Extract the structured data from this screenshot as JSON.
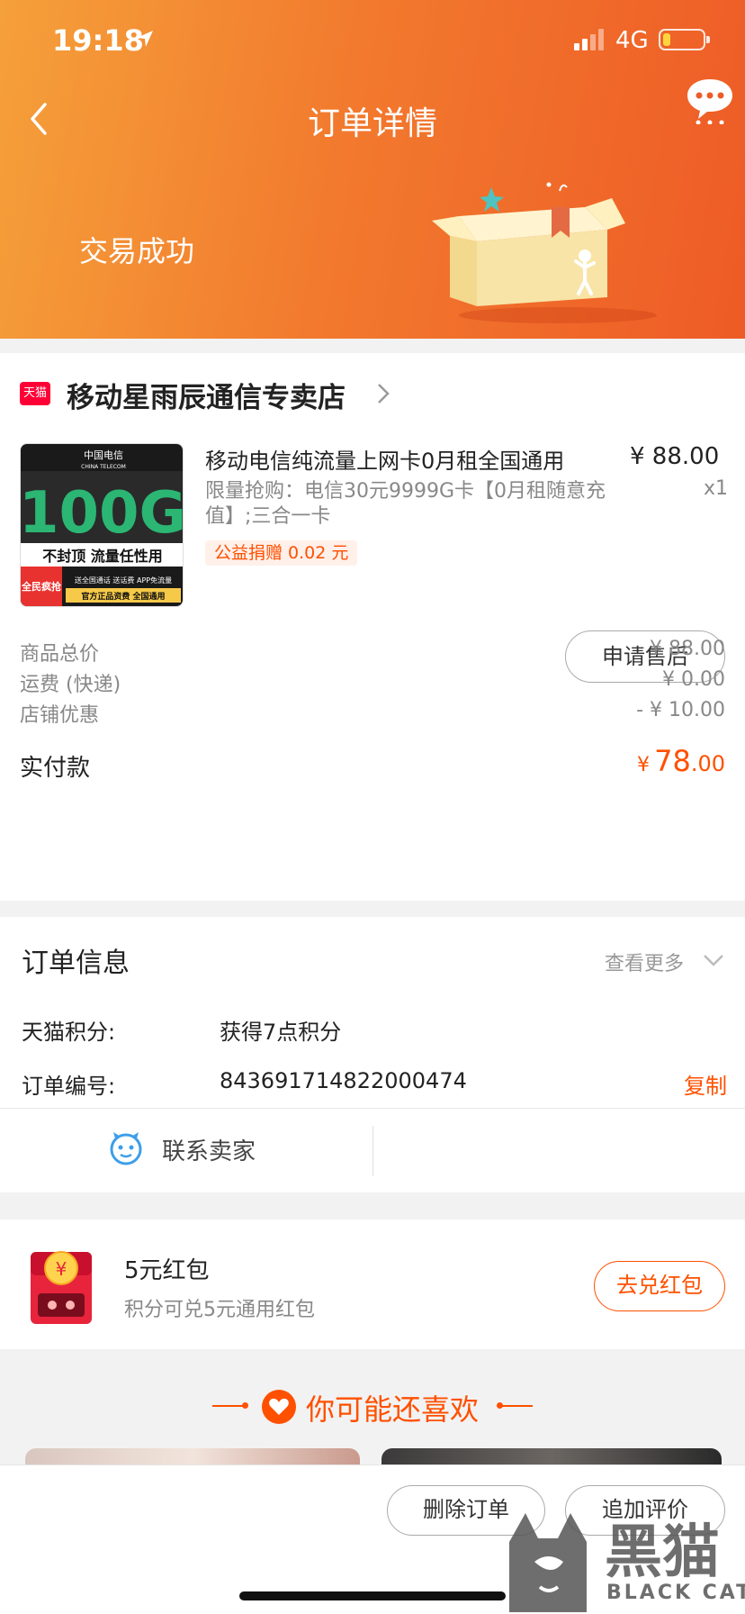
{
  "status_bar": {
    "time": "19:18",
    "network": "4G"
  },
  "nav": {
    "title": "订单详情"
  },
  "order_status": {
    "text": "交易成功"
  },
  "shop": {
    "badge": "天猫",
    "name": "移动星雨辰通信专卖店"
  },
  "product": {
    "title": "移动电信纯流量上网卡0月租全国通用",
    "spec": "限量抢购：电信30元9999G卡【0月租随意充值】;三合一卡",
    "price": "¥ 88.00",
    "quantity": "x1",
    "tag": "公益捐赠 0.02 元",
    "image": {
      "brand": "中国电信",
      "brand_en": "CHINA TELECOM",
      "big": "100G",
      "slogan": "不封顶 流量任性用",
      "corner": "全民疯抢",
      "line1": "送全国通话 送话费 APP免流量",
      "line2": "官方正品资费 全国通用"
    }
  },
  "actions": {
    "after_sale": "申请售后"
  },
  "summary": {
    "rows": [
      {
        "label": "商品总价",
        "value": "¥ 88.00"
      },
      {
        "label": "运费 (快递)",
        "value": "¥ 0.00"
      },
      {
        "label": "店铺优惠",
        "value": "- ¥ 10.00"
      }
    ],
    "paid_label": "实付款",
    "paid_currency": "¥",
    "paid_int": "78",
    "paid_dec": ".00"
  },
  "order_info": {
    "title": "订单信息",
    "see_more": "查看更多",
    "rows": [
      {
        "label": "天猫积分:",
        "value": "获得7点积分"
      },
      {
        "label": "订单编号:",
        "value": "843691714822000474"
      }
    ],
    "copy": "复制",
    "contact_seller": "联系卖家"
  },
  "red_packet": {
    "title": "5元红包",
    "subtitle": "积分可兑5元通用红包",
    "button": "去兑红包"
  },
  "recommend": {
    "title": "你可能还喜欢"
  },
  "bottom": {
    "delete": "删除订单",
    "review": "追加评价"
  },
  "watermark": {
    "text": "黑猫",
    "sub": "BLACK CAT"
  },
  "colors": {
    "accent": "#ff5000",
    "header_start": "#f5a03a",
    "header_end": "#ee5b26"
  }
}
